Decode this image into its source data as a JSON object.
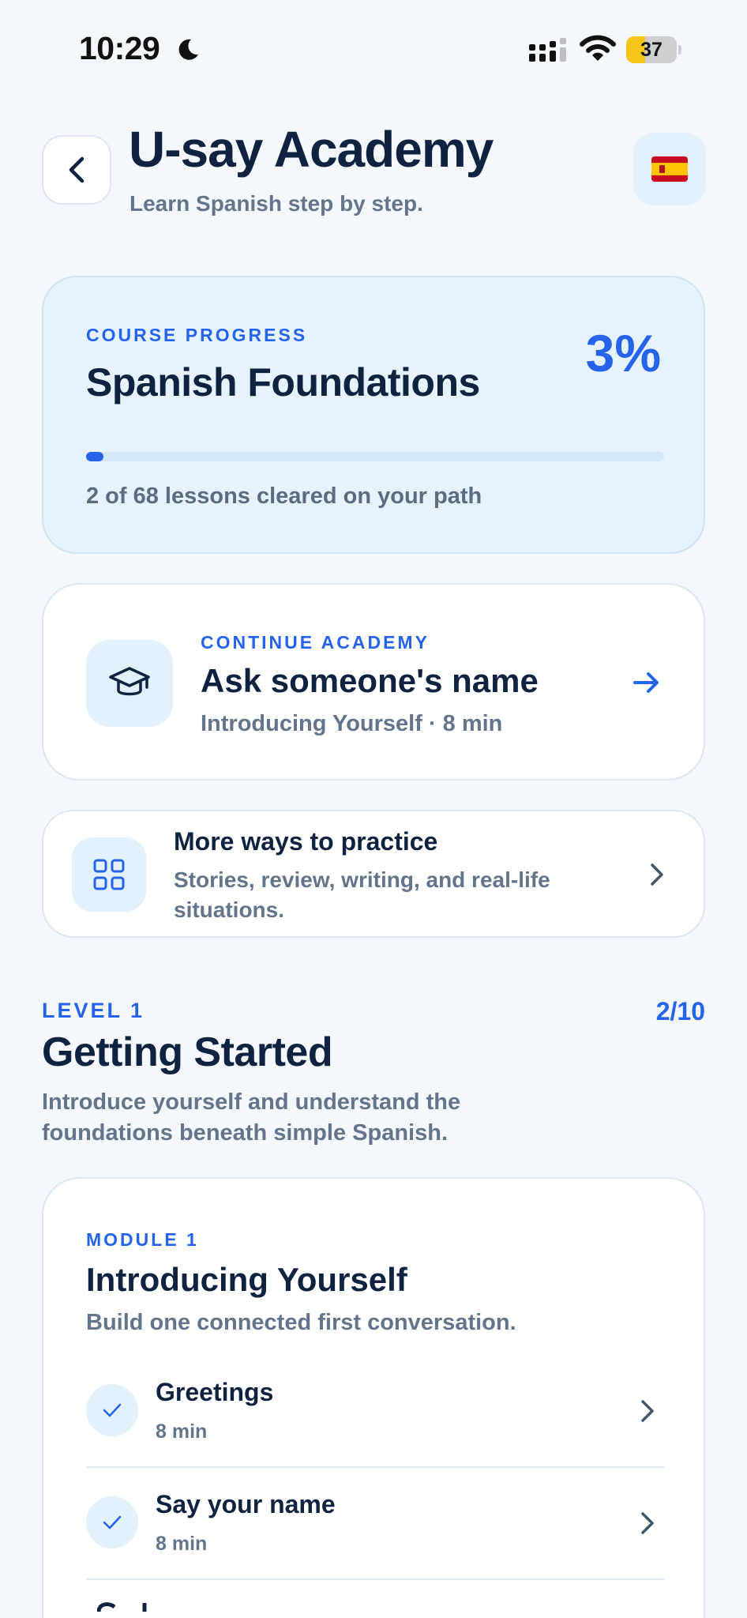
{
  "status_bar": {
    "time": "10:29",
    "battery": "37",
    "battery_level": 0.37
  },
  "header": {
    "title": "U-say Academy",
    "subtitle": "Learn Spanish step by step.",
    "flag": "🇪🇸"
  },
  "progress": {
    "eyebrow": "COURSE PROGRESS",
    "title": "Spanish Foundations",
    "percent_label": "3%",
    "percent": 3,
    "caption": "2 of 68 lessons cleared on your path"
  },
  "continue": {
    "eyebrow": "CONTINUE ACADEMY",
    "title": "Ask someone's name",
    "meta": "Introducing Yourself · 8 min"
  },
  "practice": {
    "title": "More ways to practice",
    "description": "Stories, review, writing, and real-life situations."
  },
  "level": {
    "eyebrow": "LEVEL 1",
    "count": "2/10",
    "title": "Getting Started",
    "description": "Introduce yourself and understand the foundations beneath simple Spanish."
  },
  "module": {
    "eyebrow": "MODULE 1",
    "title": "Introducing Yourself",
    "description": "Build one connected first conversation.",
    "lessons": [
      {
        "title": "Greetings",
        "duration": "8 min"
      },
      {
        "title": "Say your name",
        "duration": "8 min"
      }
    ]
  },
  "colors": {
    "accent": "#2563eb",
    "text_dark": "#0f2340",
    "text_muted": "#64748b",
    "light_blue": "#e3f1fc"
  }
}
